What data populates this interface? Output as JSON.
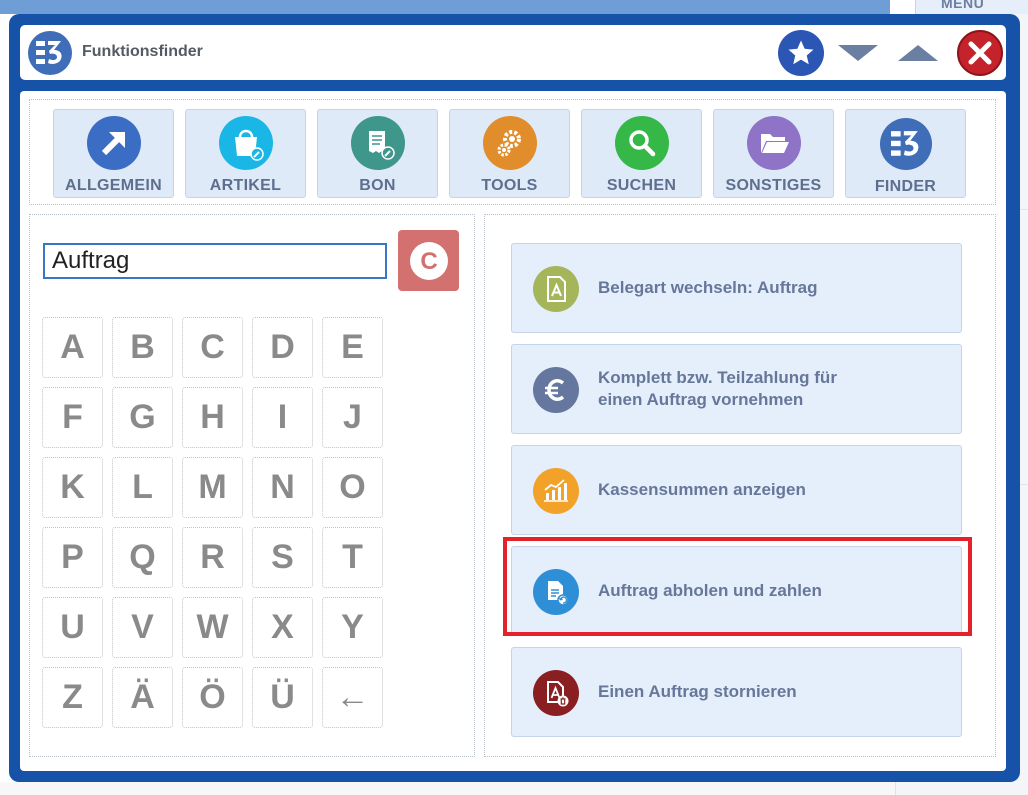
{
  "background": {
    "menu_label": "MENU"
  },
  "dialog": {
    "title": "Funktionsfinder"
  },
  "categories": [
    {
      "label": "ALLGEMEIN",
      "icon": "arrow-up-right-icon",
      "color": "#3b6dc4"
    },
    {
      "label": "ARTIKEL",
      "icon": "shopping-bag-icon",
      "color": "#1ab6e6"
    },
    {
      "label": "BON",
      "icon": "receipt-icon",
      "color": "#3f968a"
    },
    {
      "label": "TOOLS",
      "icon": "gears-icon",
      "color": "#e18d2c"
    },
    {
      "label": "SUCHEN",
      "icon": "magnifier-icon",
      "color": "#35b848"
    },
    {
      "label": "SONSTIGES",
      "icon": "folder-icon",
      "color": "#8e73c6"
    },
    {
      "label": "FINDER",
      "icon": "finder-logo-icon",
      "color": "#3f6db8"
    }
  ],
  "search": {
    "value": "Auftrag",
    "clear_label": "C"
  },
  "keyboard": {
    "rows": [
      [
        "A",
        "B",
        "C",
        "D",
        "E"
      ],
      [
        "F",
        "G",
        "H",
        "I",
        "J"
      ],
      [
        "K",
        "L",
        "M",
        "N",
        "O"
      ],
      [
        "P",
        "Q",
        "R",
        "S",
        "T"
      ],
      [
        "U",
        "V",
        "W",
        "X",
        "Y"
      ],
      [
        "Z",
        "Ä",
        "Ö",
        "Ü",
        "←"
      ]
    ]
  },
  "functions": [
    {
      "line1": "Belegart wechseln: Auftrag",
      "line2": "",
      "icon": "document-a-icon",
      "color": "#a4b55a"
    },
    {
      "line1": "Komplett bzw. Teilzahlung für",
      "line2": "einen Auftrag vornehmen",
      "icon": "euro-icon",
      "color": "#65779e"
    },
    {
      "line1": "Kassensummen anzeigen",
      "line2": "",
      "icon": "chart-icon",
      "color": "#f2a229"
    },
    {
      "line1": "Auftrag abholen und zahlen",
      "line2": "",
      "icon": "document-fetch-icon",
      "color": "#2f8fd6"
    },
    {
      "line1": "Einen Auftrag stornieren",
      "line2": "",
      "icon": "document-delete-icon",
      "color": "#8a1f22"
    }
  ],
  "highlighted_function_index": 3
}
